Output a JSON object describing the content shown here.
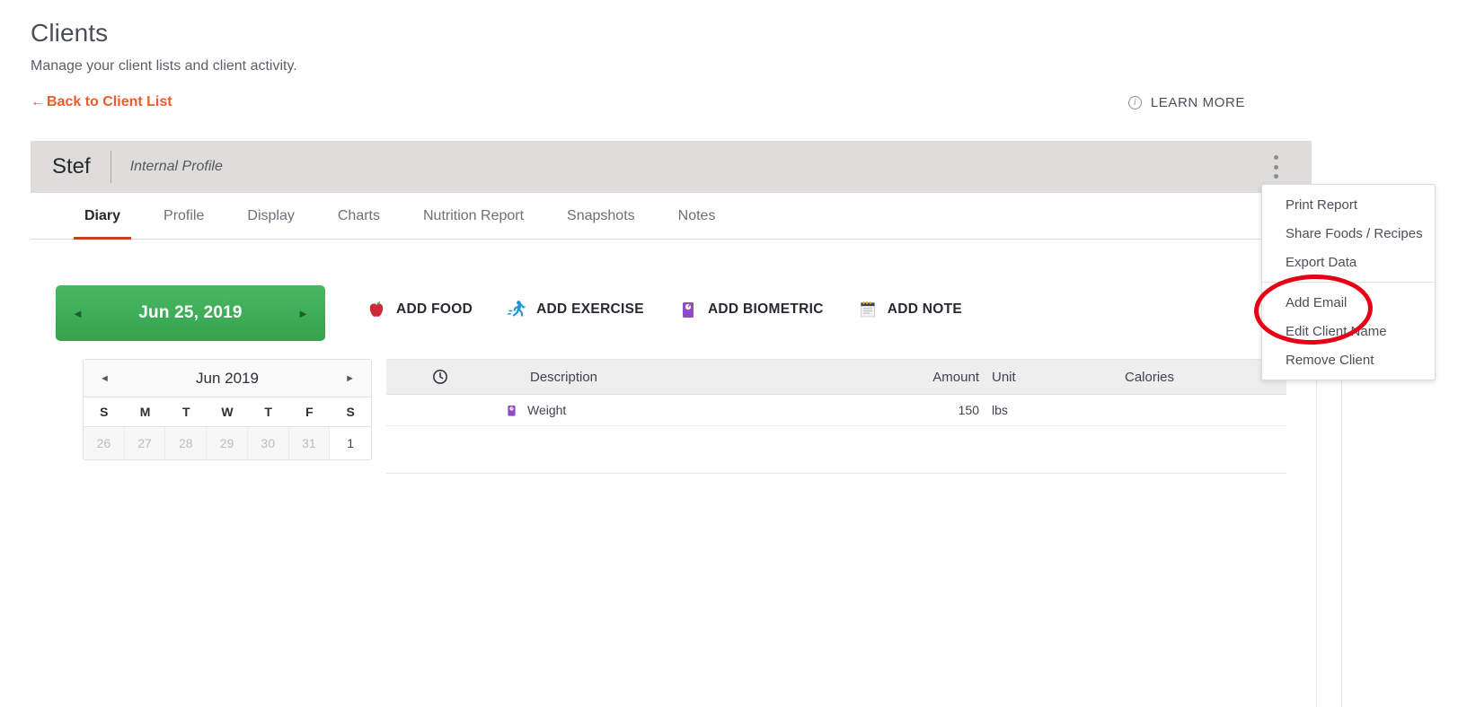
{
  "header": {
    "title": "Clients",
    "subtitle": "Manage your client lists and client activity.",
    "back_link": "Back to Client List",
    "back_arrow": "←",
    "learn_more": "LEARN MORE",
    "info_icon_glyph": "i"
  },
  "client": {
    "name": "Stef",
    "profile_type": "Internal Profile"
  },
  "tabs": [
    {
      "label": "Diary",
      "active": true
    },
    {
      "label": "Profile",
      "active": false
    },
    {
      "label": "Display",
      "active": false
    },
    {
      "label": "Charts",
      "active": false
    },
    {
      "label": "Nutrition Report",
      "active": false
    },
    {
      "label": "Snapshots",
      "active": false
    },
    {
      "label": "Notes",
      "active": false
    }
  ],
  "date_nav": {
    "prev_glyph": "◄",
    "next_glyph": "►",
    "current_date": "Jun 25, 2019"
  },
  "quick_actions": [
    {
      "label": "ADD FOOD",
      "icon": "apple-icon"
    },
    {
      "label": "ADD EXERCISE",
      "icon": "runner-icon"
    },
    {
      "label": "ADD BIOMETRIC",
      "icon": "scale-icon"
    },
    {
      "label": "ADD NOTE",
      "icon": "notepad-icon"
    }
  ],
  "calendar": {
    "prev_glyph": "◄",
    "next_glyph": "►",
    "month_label": "Jun 2019",
    "dow": [
      "S",
      "M",
      "T",
      "W",
      "T",
      "F",
      "S"
    ],
    "weeks": [
      [
        {
          "day": "26",
          "muted": true
        },
        {
          "day": "27",
          "muted": true
        },
        {
          "day": "28",
          "muted": true
        },
        {
          "day": "29",
          "muted": true
        },
        {
          "day": "30",
          "muted": true
        },
        {
          "day": "31",
          "muted": true
        },
        {
          "day": "1",
          "muted": false
        }
      ]
    ]
  },
  "diary_table": {
    "columns": [
      "",
      "Description",
      "Amount",
      "Unit",
      "Calories"
    ],
    "clock_icon": "clock-icon",
    "rows": [
      {
        "icon": "scale-icon",
        "description": "Weight",
        "amount": "150",
        "unit": "lbs",
        "calories": ""
      }
    ]
  },
  "kebab_menu": {
    "items": [
      {
        "label": "Print Report",
        "separator_after": false
      },
      {
        "label": "Share Foods / Recipes",
        "separator_after": false
      },
      {
        "label": "Export Data",
        "separator_after": true
      },
      {
        "label": "Add Email",
        "separator_after": false,
        "highlighted": true
      },
      {
        "label": "Edit Client Name",
        "separator_after": false
      },
      {
        "label": "Remove Client",
        "separator_after": false
      }
    ]
  },
  "colors": {
    "accent_orange": "#ec5c2b",
    "tab_underline": "#c24516",
    "date_green": "#3aa754",
    "annotation_red": "#e60016",
    "client_bar_gray": "#dedddb"
  }
}
